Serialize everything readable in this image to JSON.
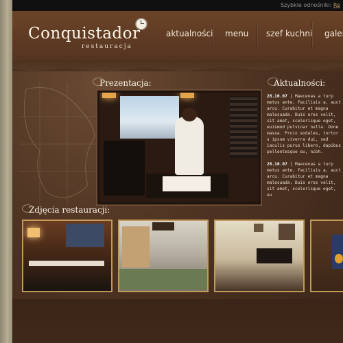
{
  "quick_links": {
    "label": "Szybkie odnośniki:",
    "link": "Re"
  },
  "brand": {
    "name": "Conquistador",
    "tagline": "restauracja"
  },
  "nav": {
    "items": [
      "aktualności",
      "menu",
      "szef kuchni",
      "galeri"
    ]
  },
  "sections": {
    "presentation_title": "Prezentacja:",
    "news_title": "Aktualności:",
    "gallery_title": "Zdjęcia restauracji:"
  },
  "news": {
    "items": [
      {
        "date": "28.10.07",
        "text": "| Maecenas a turp metus ante, facilisis a, auct arcu. Curabitur et magna malesuada. Duis eros velit, sit amet, scelerisque eget, euismod pulvinar nulla. Done massa. Proin sodales, tortor s ipsum viverra dui, sed iaculis purus libero, dapibus pellentesque eu, nibh."
      },
      {
        "date": "28.10.07",
        "text": "| Maecenas a turp metus ante, facilisis a, auct arcu. Curabitur et magna malesuada. Duis eros velit, sit amet, scelerisque eget, eu"
      }
    ]
  },
  "colors": {
    "background": "#4e3322",
    "header": "#5b3822",
    "gallery_border": "#c29a5c",
    "text_light": "#fbf3e5"
  }
}
